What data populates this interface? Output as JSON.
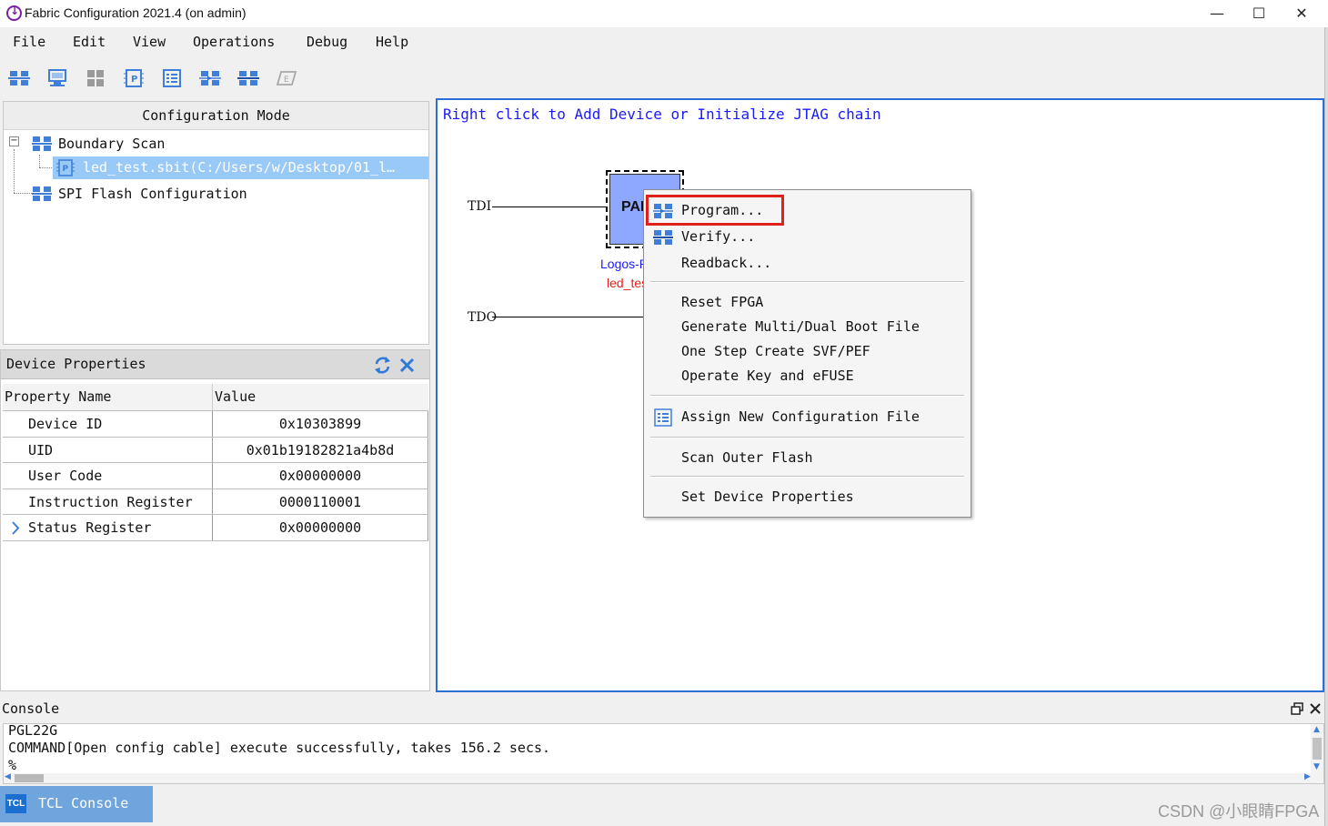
{
  "window": {
    "title": "Fabric Configuration 2021.4 (on admin)",
    "controls": {
      "minimize": "—",
      "maximize": "☐",
      "close": "✕"
    }
  },
  "menu": [
    "File",
    "Edit",
    "View",
    "Operations",
    "Debug",
    "Help"
  ],
  "toolbar": {
    "icons": [
      "boundary-scan-icon",
      "cable-icon",
      "grid-icon",
      "chip-icon",
      "list-icon",
      "program-icon",
      "verify-icon",
      "erase-icon"
    ]
  },
  "config_panel": {
    "header": "Configuration Mode",
    "tree": [
      {
        "label": "Boundary Scan",
        "expanded": true
      },
      {
        "label": "led_test.sbit(C:/Users/w/Desktop/01_l…",
        "selected": true
      },
      {
        "label": "SPI Flash Configuration"
      }
    ]
  },
  "device_properties": {
    "title": "Device Properties",
    "columns": [
      "Property Name",
      "Value"
    ],
    "rows": [
      {
        "name": "Device ID",
        "value": "0x10303899"
      },
      {
        "name": "UID",
        "value": "0x01b19182821a4b8d"
      },
      {
        "name": "User Code",
        "value": "0x00000000"
      },
      {
        "name": "Instruction Register",
        "value": "0000110001"
      },
      {
        "name": "Status Register",
        "value": "0x00000000",
        "expandable": true
      }
    ]
  },
  "canvas": {
    "hint": "Right click to Add Device or Initialize JTAG chain",
    "tdi": "TDI",
    "tdo": "TDO",
    "chip_label": "PAN",
    "device_name": "Logos-P",
    "file_name": "led_tes",
    "chip_color": "#8fa8ff"
  },
  "context_menu": {
    "items": [
      {
        "label": "Program...",
        "icon": "program-icon",
        "highlighted": true
      },
      {
        "label": "Verify...",
        "icon": "verify-icon"
      },
      {
        "label": "Readback..."
      },
      {
        "label": "Reset FPGA"
      },
      {
        "label": "Generate Multi/Dual Boot File"
      },
      {
        "label": "One Step Create SVF/PEF"
      },
      {
        "label": "Operate Key and eFUSE"
      },
      {
        "label": "Assign New Configuration File",
        "icon": "list-icon"
      },
      {
        "label": "Scan Outer Flash"
      },
      {
        "label": "Set Device Properties"
      }
    ],
    "highlight_color": "#e0201a"
  },
  "console": {
    "title": "Console",
    "lines": [
      "PGL22G",
      "COMMAND[Open config cable] execute successfully, takes 156.2 secs.",
      "%"
    ]
  },
  "tabs": [
    {
      "icon_text": "TCL",
      "label": "TCL Console",
      "active": true
    }
  ],
  "watermark": "CSDN @小眼睛FPGA",
  "colors": {
    "accent": "#2a6fd6",
    "selection": "#99c9f7",
    "link_text": "#1a1aff"
  }
}
